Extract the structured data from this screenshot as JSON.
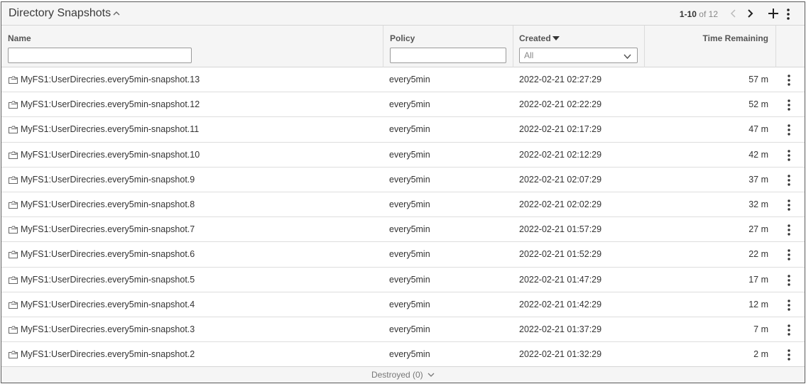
{
  "header": {
    "title": "Directory Snapshots",
    "range": "1-10",
    "of_text": "of 12"
  },
  "columns": {
    "name": "Name",
    "policy": "Policy",
    "created": "Created",
    "time_remaining": "Time Remaining",
    "created_filter_value": "All"
  },
  "rows": [
    {
      "name": "MyFS1:UserDirecries.every5min-snapshot.13",
      "policy": "every5min",
      "created": "2022-02-21 02:27:29",
      "time": "57 m"
    },
    {
      "name": "MyFS1:UserDirecries.every5min-snapshot.12",
      "policy": "every5min",
      "created": "2022-02-21 02:22:29",
      "time": "52 m"
    },
    {
      "name": "MyFS1:UserDirecries.every5min-snapshot.11",
      "policy": "every5min",
      "created": "2022-02-21 02:17:29",
      "time": "47 m"
    },
    {
      "name": "MyFS1:UserDirecries.every5min-snapshot.10",
      "policy": "every5min",
      "created": "2022-02-21 02:12:29",
      "time": "42 m"
    },
    {
      "name": "MyFS1:UserDirecries.every5min-snapshot.9",
      "policy": "every5min",
      "created": "2022-02-21 02:07:29",
      "time": "37 m"
    },
    {
      "name": "MyFS1:UserDirecries.every5min-snapshot.8",
      "policy": "every5min",
      "created": "2022-02-21 02:02:29",
      "time": "32 m"
    },
    {
      "name": "MyFS1:UserDirecries.every5min-snapshot.7",
      "policy": "every5min",
      "created": "2022-02-21 01:57:29",
      "time": "27 m"
    },
    {
      "name": "MyFS1:UserDirecries.every5min-snapshot.6",
      "policy": "every5min",
      "created": "2022-02-21 01:52:29",
      "time": "22 m"
    },
    {
      "name": "MyFS1:UserDirecries.every5min-snapshot.5",
      "policy": "every5min",
      "created": "2022-02-21 01:47:29",
      "time": "17 m"
    },
    {
      "name": "MyFS1:UserDirecries.every5min-snapshot.4",
      "policy": "every5min",
      "created": "2022-02-21 01:42:29",
      "time": "12 m"
    },
    {
      "name": "MyFS1:UserDirecries.every5min-snapshot.3",
      "policy": "every5min",
      "created": "2022-02-21 01:37:29",
      "time": "7 m"
    },
    {
      "name": "MyFS1:UserDirecries.every5min-snapshot.2",
      "policy": "every5min",
      "created": "2022-02-21 01:32:29",
      "time": "2 m"
    }
  ],
  "footer": {
    "destroyed_label": "Destroyed (0)"
  },
  "icons": {
    "title_toggle": "chevron-up-icon",
    "prev": "chevron-left-icon",
    "next": "chevron-right-icon",
    "add": "plus-icon",
    "menu": "more-vertical-icon",
    "row_item": "snapshot-folder-icon",
    "filter_dropdown": "chevron-down-icon",
    "footer_toggle": "chevron-down-icon"
  }
}
